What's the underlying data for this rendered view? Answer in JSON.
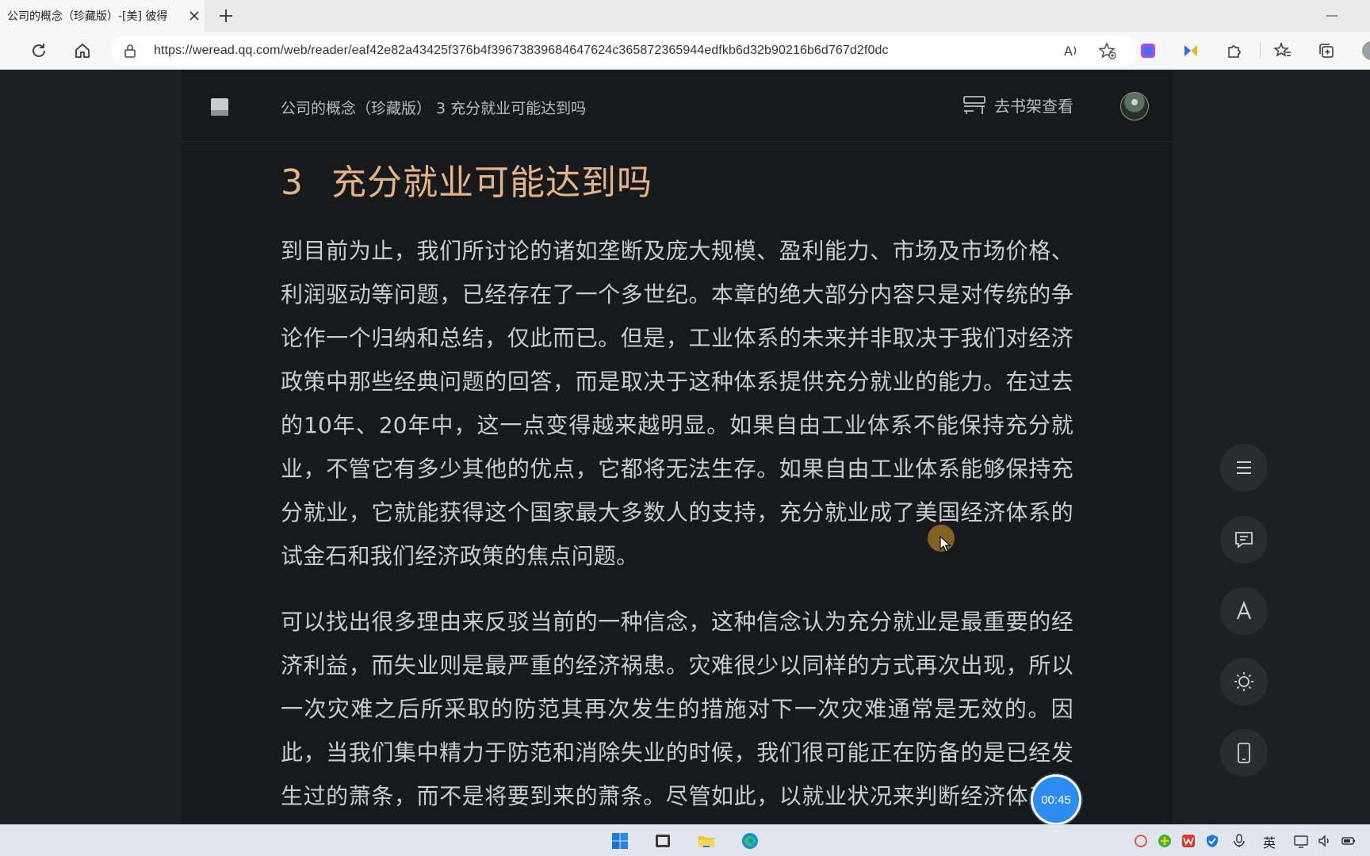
{
  "browser": {
    "tab_title": "公司的概念（珍藏版）-[美] 彼得",
    "url": "https://weread.qq.com/web/reader/eaf42e82a43425f376b4f39673839684647624c365872365944edfkb6d32b90216b6d767d2f0dc"
  },
  "reader": {
    "breadcrumb": "公司的概念（珍藏版） 3 充分就业可能达到吗",
    "shelf_label": "去书架查看",
    "chapter_number": "3",
    "chapter_title": "充分就业可能达到吗",
    "paragraphs": [
      "到目前为止，我们所讨论的诸如垄断及庞大规模、盈利能力、市场及市场价格、利润驱动等问题，已经存在了一个多世纪。本章的绝大部分内容只是对传统的争论作一个归纳和总结，仅此而已。但是，工业体系的未来并非取决于我们对经济政策中那些经典问题的回答，而是取决于这种体系提供充分就业的能力。在过去的10年、20年中，这一点变得越来越明显。如果自由工业体系不能保持充分就业，不管它有多少其他的优点，它都将无法生存。如果自由工业体系能够保持充分就业，它就能获得这个国家最大多数人的支持，充分就业成了美国经济体系的试金石和我们经济政策的焦点问题。",
      "可以找出很多理由来反驳当前的一种信念，这种信念认为充分就业是最重要的经济利益，而失业则是最严重的经济祸患。灾难很少以同样的方式再次出现，所以一次灾难之后所采取的防范其再次发生的措施对下一次灾难通常是无效的。因此，当我们集中精力于防范和消除失业的时候，我们很可能正在防备的是已经发生过的萧条，而不是将要到来的萧条。尽管如此，以就业状况来判断经济体系是否具有存"
    ],
    "timer": "00:45"
  },
  "sidebar_tools": [
    "menu-icon",
    "comment-icon",
    "font-icon",
    "brightness-icon",
    "phone-icon"
  ],
  "taskbar": {
    "ime_label": "英"
  },
  "colors": {
    "accent_title": "#e3b48a",
    "reader_bg": "#17191b",
    "timer": "#2d8cf0"
  }
}
